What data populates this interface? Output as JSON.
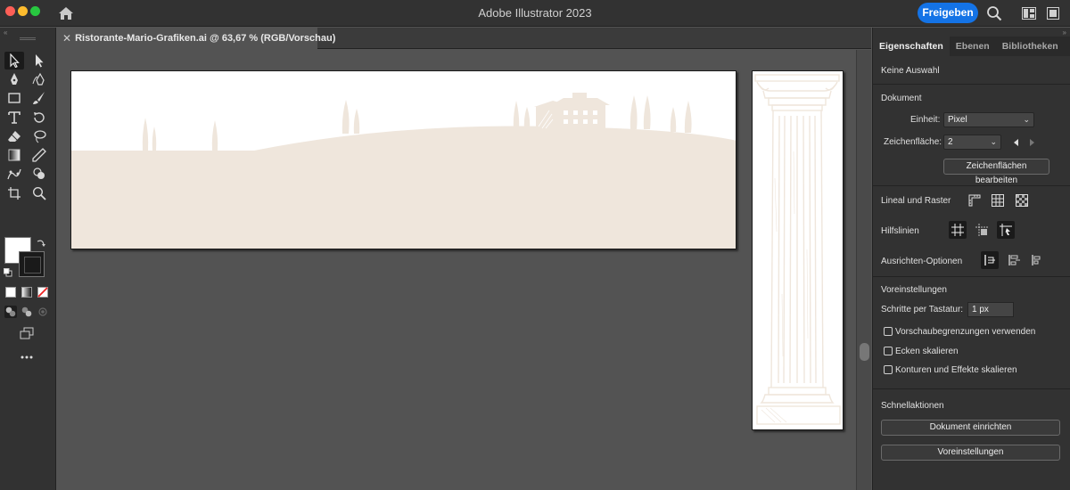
{
  "app": {
    "title": "Adobe Illustrator 2023",
    "share_label": "Freigeben"
  },
  "document_tab": {
    "close_glyph": "✕",
    "title": "Ristorante-Mario-Grafiken.ai @ 63,67 % (RGB/Vorschau)"
  },
  "colors": {
    "accent": "#1473e6",
    "artwork": "#efe6dc",
    "chrome": "#323232",
    "canvas": "#535353"
  },
  "tools": [
    {
      "name": "selection-tool-icon",
      "selected": true
    },
    {
      "name": "direct-selection-tool-icon"
    },
    {
      "name": "pen-tool-icon"
    },
    {
      "name": "curvature-tool-icon"
    },
    {
      "name": "rectangle-tool-icon"
    },
    {
      "name": "paintbrush-tool-icon"
    },
    {
      "name": "type-tool-icon"
    },
    {
      "name": "rotate-tool-icon"
    },
    {
      "name": "eraser-tool-icon"
    },
    {
      "name": "lasso-tool-icon"
    },
    {
      "name": "gradient-tool-icon"
    },
    {
      "name": "eyedropper-tool-icon"
    },
    {
      "name": "puppet-warp-tool-icon"
    },
    {
      "name": "shape-builder-tool-icon"
    },
    {
      "name": "artboard-tool-icon"
    },
    {
      "name": "zoom-tool-icon"
    }
  ],
  "panel": {
    "tabs": [
      "Eigenschaften",
      "Ebenen",
      "Bibliotheken"
    ],
    "no_selection": "Keine Auswahl",
    "document": {
      "heading": "Dokument",
      "unit_label": "Einheit:",
      "unit_value": "Pixel",
      "artboard_label": "Zeichenfläche:",
      "artboard_value": "2",
      "edit_artboards_label": "Zeichenflächen bearbeiten"
    },
    "rulers_grid": {
      "label": "Lineal und Raster"
    },
    "guides": {
      "label": "Hilfslinien"
    },
    "align_options": {
      "label": "Ausrichten-Optionen"
    },
    "preferences": {
      "heading": "Voreinstellungen",
      "keyboard_increment_label": "Schritte per Tastatur:",
      "keyboard_increment_value": "1 px",
      "checkboxes": [
        "Vorschaubegrenzungen verwenden",
        "Ecken skalieren",
        "Konturen und Effekte skalieren"
      ]
    },
    "quick_actions": {
      "heading": "Schnellaktionen",
      "buttons": [
        "Dokument einrichten",
        "Voreinstellungen"
      ]
    }
  }
}
